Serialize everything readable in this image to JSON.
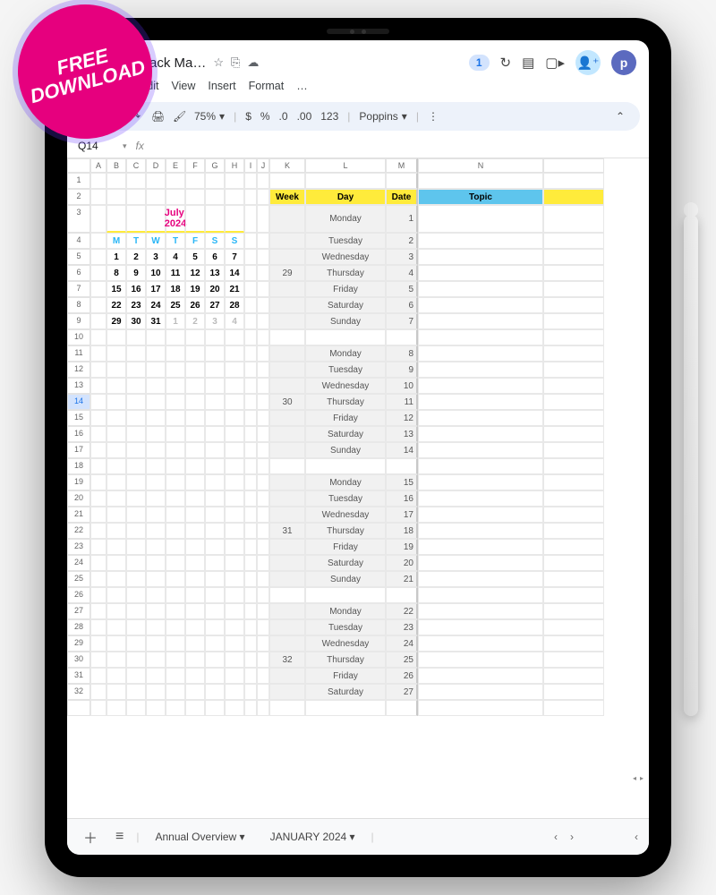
{
  "badge": {
    "line1": "FREE",
    "line2": "DOWNLOAD"
  },
  "header": {
    "doc_title": "ackerjack Ma…",
    "menus": [
      "e",
      "Edit",
      "View",
      "Insert",
      "Format",
      "…"
    ],
    "notif_count": "1",
    "avatar_initial": "p"
  },
  "toolbar": {
    "zoom": "75%",
    "currency": "$",
    "percent": "%",
    "dec_dec": ".0",
    "dec_inc": ".00",
    "num_fmt": "123",
    "font": "Poppins"
  },
  "namebox": {
    "cell": "Q14",
    "fx": "fx"
  },
  "columns": [
    "A",
    "B",
    "C",
    "D",
    "E",
    "F",
    "G",
    "H",
    "I",
    "J",
    "K",
    "L",
    "M",
    "N",
    ""
  ],
  "rows_visible": [
    "1",
    "2",
    "3",
    "4",
    "5",
    "6",
    "7",
    "8",
    "9",
    "10",
    "11",
    "12",
    "13",
    "14",
    "15",
    "16",
    "17",
    "18",
    "19",
    "20",
    "21",
    "22",
    "23",
    "24",
    "25",
    "26",
    "27",
    "28",
    "29",
    "30",
    "31",
    "32",
    ""
  ],
  "planner_headers": {
    "week": "Week",
    "day": "Day",
    "date": "Date",
    "topic": "Topic"
  },
  "mini_cal": {
    "title": "July 2024",
    "dow": [
      "M",
      "T",
      "W",
      "T",
      "F",
      "S",
      "S"
    ],
    "weeks": [
      [
        "1",
        "2",
        "3",
        "4",
        "5",
        "6",
        "7"
      ],
      [
        "8",
        "9",
        "10",
        "11",
        "12",
        "13",
        "14"
      ],
      [
        "15",
        "16",
        "17",
        "18",
        "19",
        "20",
        "21"
      ],
      [
        "22",
        "23",
        "24",
        "25",
        "26",
        "27",
        "28"
      ],
      [
        "29",
        "30",
        "31",
        "1",
        "2",
        "3",
        "4"
      ]
    ],
    "grey_start": [
      5,
      3
    ]
  },
  "weeks": [
    {
      "num": "29",
      "days": [
        "Monday",
        "Tuesday",
        "Wednesday",
        "Thursday",
        "Friday",
        "Saturday",
        "Sunday"
      ],
      "dates": [
        "1",
        "2",
        "3",
        "4",
        "5",
        "6",
        "7"
      ]
    },
    {
      "num": "30",
      "days": [
        "Monday",
        "Tuesday",
        "Wednesday",
        "Thursday",
        "Friday",
        "Saturday",
        "Sunday"
      ],
      "dates": [
        "8",
        "9",
        "10",
        "11",
        "12",
        "13",
        "14"
      ]
    },
    {
      "num": "31",
      "days": [
        "Monday",
        "Tuesday",
        "Wednesday",
        "Thursday",
        "Friday",
        "Saturday",
        "Sunday"
      ],
      "dates": [
        "15",
        "16",
        "17",
        "18",
        "19",
        "20",
        "21"
      ]
    },
    {
      "num": "32",
      "days": [
        "Monday",
        "Tuesday",
        "Wednesday",
        "Thursday",
        "Friday",
        "Saturday"
      ],
      "dates": [
        "22",
        "23",
        "24",
        "25",
        "26",
        "27"
      ]
    }
  ],
  "tabs": {
    "t1": "Annual Overview",
    "t2": "JANUARY 2024"
  }
}
